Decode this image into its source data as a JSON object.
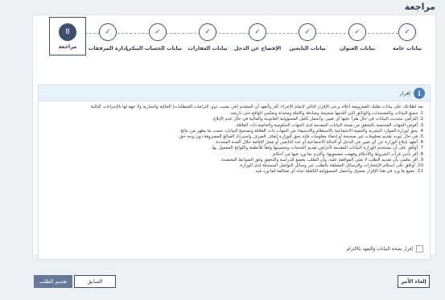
{
  "page": {
    "title": "مراجعة"
  },
  "stepper": {
    "steps": [
      {
        "label": "بيانات عامة",
        "icon": "check-icon",
        "state": "done"
      },
      {
        "label": "بيانات العنوان",
        "icon": "check-icon",
        "state": "done"
      },
      {
        "label": "بيانات التابعين",
        "icon": "check-icon",
        "state": "done"
      },
      {
        "label": "الإفصاح عن الدخل",
        "icon": "check-icon",
        "state": "done"
      },
      {
        "label": "بيانات العقارات",
        "icon": "check-icon",
        "state": "done"
      },
      {
        "label": "بيانات الحساب البنكي",
        "icon": "check-icon",
        "state": "done"
      },
      {
        "label": "إدارة المرفقات",
        "icon": "check-icon",
        "state": "done"
      },
      {
        "label": "مراجعة",
        "number": "8",
        "state": "active"
      }
    ]
  },
  "declaration": {
    "title": "إقرار",
    "intro": "بعد اطلاعك على بيانات طلبك المعروضة أعلاه يرجى الإقرار التالي لإتمام الإجراء: أقر وأتعهد أن المتقدم (في نصيب ذوي التزامات المتطلبات) الحالية والسارية ولا جهة لها بالإجراءات التالية:",
    "items": [
      "1. جميع البيانات والمستندات والوثائق التي أقدمها صحيحة وصادقة وكاملة ومحدثة وتعكس الواقع حتى تاريخه.",
      "2. التزامي بتحديث البيانات في حال طرأ عليها أي تغيير، وأتحمل كامل المسؤولية القانونية والمالية في حال عدم الإبلاغ.",
      "3. أفوض الجهات المختصة بالتحقق من صحة البيانات المقدمة لدى الجهات الحكومية والخاصة ذات العلاقة.",
      "4. يحق لوزارة الموارد البشرية والتنمية الاجتماعية بالاستعلام والاستيفاء من الجهات ذات العلاقة وتصحيح البيانات حسب ما يظهر من نتائج.",
      "5. في حال ثبوت تقديم معلومات غير صحيحة أو إخفاء معلومات فإنه يحق للوزارة إيقاف الصرف واسترداد المبالغ المصروفة دون وجه حق.",
      "6. أتعهد بإبلاغ الوزارة عن أي تغيير في الدخل أو الحالة الاجتماعية أو عدد التابعين أو محل الإقامة خلال المدة المحددة.",
      "7. أوافق على أن تستخدم الوزارة البيانات المقدمة لأغراض تقديم الخدمات وتحسينها وفقاً للأنظمة واللوائح المعمول بها.",
      "8. أقر بأنني قرأت الشروط والأحكام وفهمت مضمونها، وألتزم بما ورد فيها من أحكام.",
      "9. أقر بعلمي بأن تقديم الطلب لا يعني الموافقة عليه، وأن الطلب يخضع للدراسة والتحقق وفق الضوابط المعتمدة.",
      "10. أوافق على استلام الإشعارات والرسائل المتعلقة بالطلب عبر وسائل التواصل المسجلة لدى الوزارة.",
      "11. جميع ما ورد في هذا الإقرار صحيح، وأتحمل المسؤولية الكاملة تجاه أي مخالفة لما ورد فيه."
    ],
    "agree_label": "إقرار بصحة البيانات والتعهد بالالتزام",
    "agree_checked": false
  },
  "footer": {
    "cancel_label": "إلغاء الأمر",
    "prev_label": "السابق",
    "submit_label": "تقديم الطلب"
  }
}
